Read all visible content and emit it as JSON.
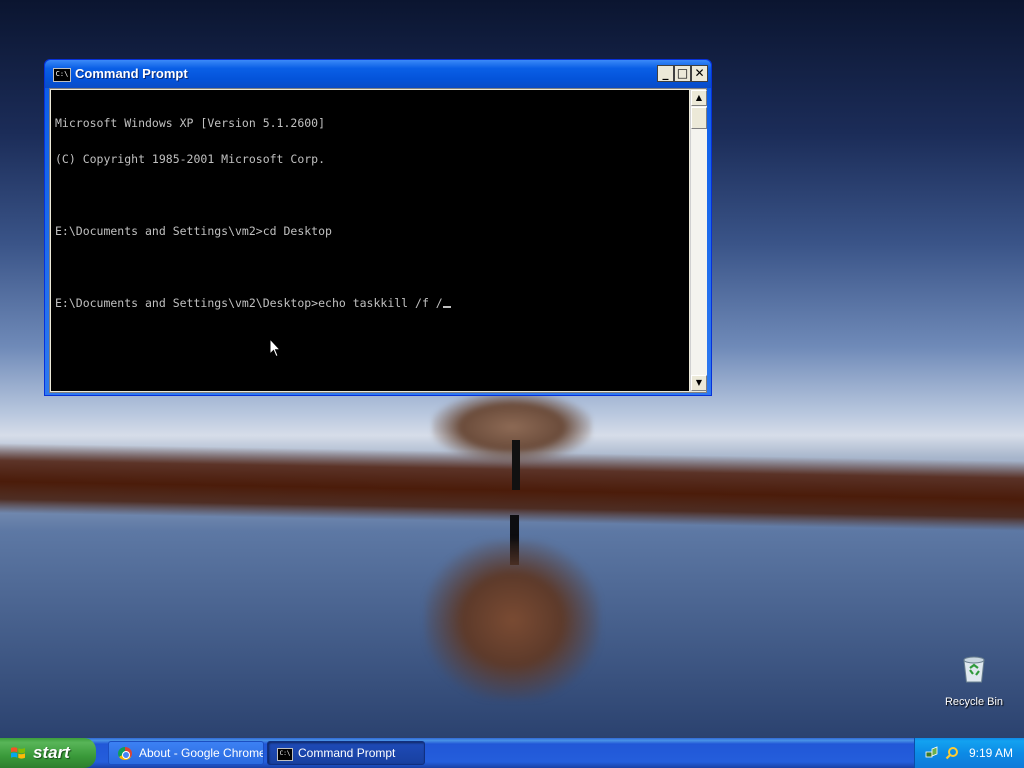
{
  "window": {
    "title": "Command Prompt",
    "minimize_label": "_",
    "maximize_label": "□",
    "close_label": "✕",
    "icon": "cmd-icon"
  },
  "console": {
    "lines": [
      "Microsoft Windows XP [Version 5.1.2600]",
      "(C) Copyright 1985-2001 Microsoft Corp.",
      "",
      "E:\\Documents and Settings\\vm2>cd Desktop",
      "",
      "E:\\Documents and Settings\\vm2\\Desktop>echo taskkill /f /"
    ]
  },
  "desktop": {
    "icons": [
      {
        "label": "Recycle Bin",
        "icon": "recycle-bin-icon"
      }
    ]
  },
  "taskbar": {
    "start_label": "start",
    "items": [
      {
        "label": "About - Google Chrome",
        "icon": "chrome-icon",
        "active": false
      },
      {
        "label": "Command Prompt",
        "icon": "cmd-icon",
        "active": true
      }
    ],
    "tray": {
      "icons": [
        "network-icon",
        "search-icon"
      ],
      "clock": "9:19 AM"
    }
  },
  "colors": {
    "titlebar": "#0a5fe6",
    "taskbar": "#245edc",
    "start_button": "#3a9a3a",
    "console_bg": "#000000",
    "console_fg": "#c0c0c0"
  }
}
